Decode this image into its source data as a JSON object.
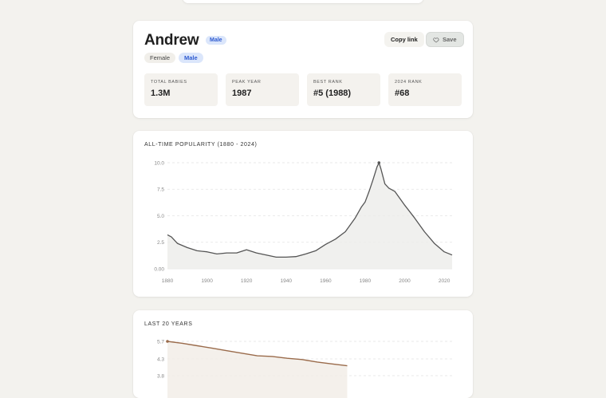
{
  "name_card": {
    "name": "Andrew",
    "gender_badge": "Male",
    "toggles": [
      {
        "label": "Female",
        "active": false
      },
      {
        "label": "Male",
        "active": true
      }
    ],
    "copy_label": "Copy link",
    "save_label": "Save",
    "stats": [
      {
        "label": "TOTAL BABIES",
        "value": "1.3M"
      },
      {
        "label": "PEAK YEAR",
        "value": "1987"
      },
      {
        "label": "BEST RANK",
        "value": "#5 (1988)"
      },
      {
        "label": "2024 RANK",
        "value": "#68"
      }
    ],
    "accent_color": "#2f5bd0"
  },
  "popularity": {
    "title": "ALL-TIME POPULARITY (1880 - 2024)"
  },
  "recent": {
    "title": "LAST 20 YEARS"
  },
  "chart_data": [
    {
      "type": "area",
      "title": "ALL-TIME POPULARITY (1880 - 2024)",
      "xlabel": "",
      "ylabel": "",
      "xlim": [
        1880,
        2024
      ],
      "ylim": [
        0,
        10
      ],
      "x_ticks": [
        "1880",
        "1900",
        "1920",
        "1940",
        "1960",
        "1980",
        "2000",
        "2020"
      ],
      "y_ticks": [
        "0.00",
        "2.5",
        "5.0",
        "7.5",
        "10.0"
      ],
      "grid": true,
      "line_color": "#555555",
      "x": [
        1880,
        1882,
        1885,
        1890,
        1895,
        1900,
        1905,
        1910,
        1915,
        1920,
        1925,
        1930,
        1935,
        1940,
        1945,
        1950,
        1955,
        1960,
        1965,
        1970,
        1975,
        1978,
        1980,
        1982,
        1984,
        1986,
        1987,
        1988,
        1990,
        1992,
        1995,
        2000,
        2005,
        2010,
        2015,
        2020,
        2024
      ],
      "values": [
        3.2,
        3.0,
        2.4,
        2.0,
        1.7,
        1.6,
        1.4,
        1.5,
        1.5,
        1.8,
        1.5,
        1.3,
        1.1,
        1.1,
        1.15,
        1.4,
        1.7,
        2.3,
        2.8,
        3.5,
        4.8,
        5.8,
        6.3,
        7.3,
        8.4,
        9.6,
        10.0,
        9.4,
        8.0,
        7.6,
        7.3,
        6.0,
        4.8,
        3.5,
        2.4,
        1.6,
        1.3
      ],
      "peak": {
        "x": 1987,
        "y": 10.0
      }
    },
    {
      "type": "line",
      "title": "LAST 20 YEARS",
      "xlim": [
        2005,
        2024
      ],
      "y_ticks": [
        "5.7",
        "4.3",
        "3.8"
      ],
      "line_color": "#9a6b4b",
      "x": [
        2005,
        2006,
        2007,
        2008,
        2009,
        2010,
        2011,
        2012,
        2013,
        2014,
        2015,
        2016,
        2017
      ],
      "values": [
        5.7,
        5.55,
        5.35,
        5.15,
        4.95,
        4.75,
        4.55,
        4.5,
        4.35,
        4.25,
        4.05,
        3.9,
        3.75
      ]
    }
  ]
}
